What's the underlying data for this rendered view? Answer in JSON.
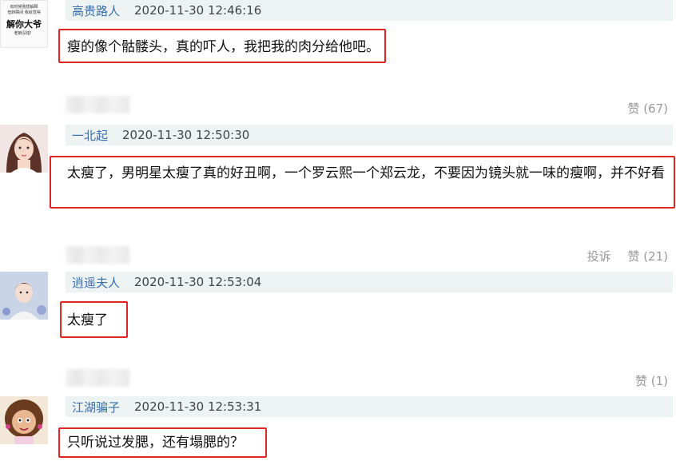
{
  "comments": [
    {
      "user": "高贵路人",
      "time": "2020-11-30 12:46:16",
      "text": "瘦的像个骷髅头，真的吓人，我把我的肉分给他吧。",
      "avatar": {
        "line1": "有时候我想解释",
        "line2": "但转瞬间 我就觉得",
        "big": "解你大爷",
        "line3": "老娘没错！"
      }
    },
    {
      "user": "一北起",
      "time": "2020-11-30 12:50:30",
      "text": "太瘦了，男明星太瘦了真的好丑啊，一个罗云熙一个郑云龙，不要因为镜头就一味的瘦啊，并不好看"
    },
    {
      "user": "逍遥夫人",
      "time": "2020-11-30 12:53:04",
      "text": "太瘦了"
    },
    {
      "user": "江湖骗子",
      "time": "2020-11-30 12:53:31",
      "text": "只听说过发腮，还有塌腮的？"
    }
  ],
  "actions": {
    "like_1": "赞 (67)",
    "report_2": "投诉",
    "like_2": "赞 (21)",
    "like_3": "赞 (1)"
  },
  "colors": {
    "name": "#3a6fa8",
    "meta_bg": "#edf3f3",
    "highlight": "#e02525"
  }
}
